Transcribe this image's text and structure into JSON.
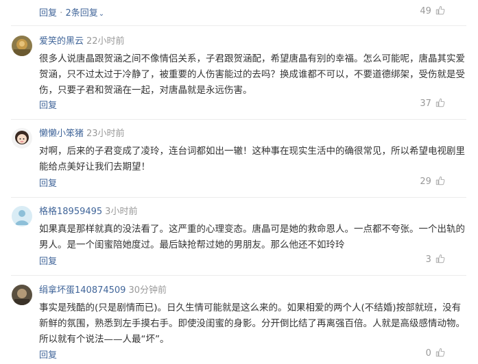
{
  "top": {
    "reply_label": "回复",
    "dot": "·",
    "replies_count_label": "2条回复",
    "likes": "49"
  },
  "comments": [
    {
      "username": "爱笑的黑云",
      "time": "22小时前",
      "text": "很多人说唐晶跟贺涵之间不像情侣关系，子君跟贺涵配，希望唐晶有别的幸福。怎么可能呢，唐晶其实爱贺涵，只不过太过于冷静了，被重要的人伤害能过的去吗？换成谁都不可以，不要道德绑架，受伤就是受伤，只要子君和贺涵在一起，对唐晶就是永远伤害。",
      "reply_label": "回复",
      "likes": "37",
      "avatar_icon": "photo-avatar-icon"
    },
    {
      "username": "懒懒小笨猪",
      "time": "23小时前",
      "text": "对啊，后来的子君变成了凌玲，连台词都如出一辙！这种事在现实生活中的确很常见，所以希望电视剧里能给点美好让我们去期望！",
      "reply_label": "回复",
      "likes": "29",
      "avatar_icon": "cartoon-girl-avatar-icon"
    },
    {
      "username": "格格18959495",
      "time": "3小时前",
      "text": "如果真是那样就真的没法看了。这严重的心理变态。唐晶可是她的救命恩人。一点都不夸张。一个出轨的男人。是一个闺蜜陪她度过。最后缺抢帮过她的男朋友。那么他还不如玲玲",
      "reply_label": "回复",
      "likes": "3",
      "avatar_icon": "default-avatar-icon"
    },
    {
      "username": "绢拿坏蛋140874509",
      "time": "30分钟前",
      "text": "事实是残酷的(只是剧情而已)。日久生情可能就是这么来的。如果相爱的两个人(不结婚)按部就班，没有新鲜的氛围，熟悉到左手摸右手。即使没闺蜜的身影。分开倒比结了再离强百倍。人就是高级感情动物。所以就有个说法——人最“坏”。",
      "reply_label": "回复",
      "likes": "0",
      "avatar_icon": "photo-avatar-icon"
    }
  ],
  "colors": {
    "link": "#406599",
    "muted": "#999999",
    "text": "#333333",
    "divider": "#ececec"
  }
}
